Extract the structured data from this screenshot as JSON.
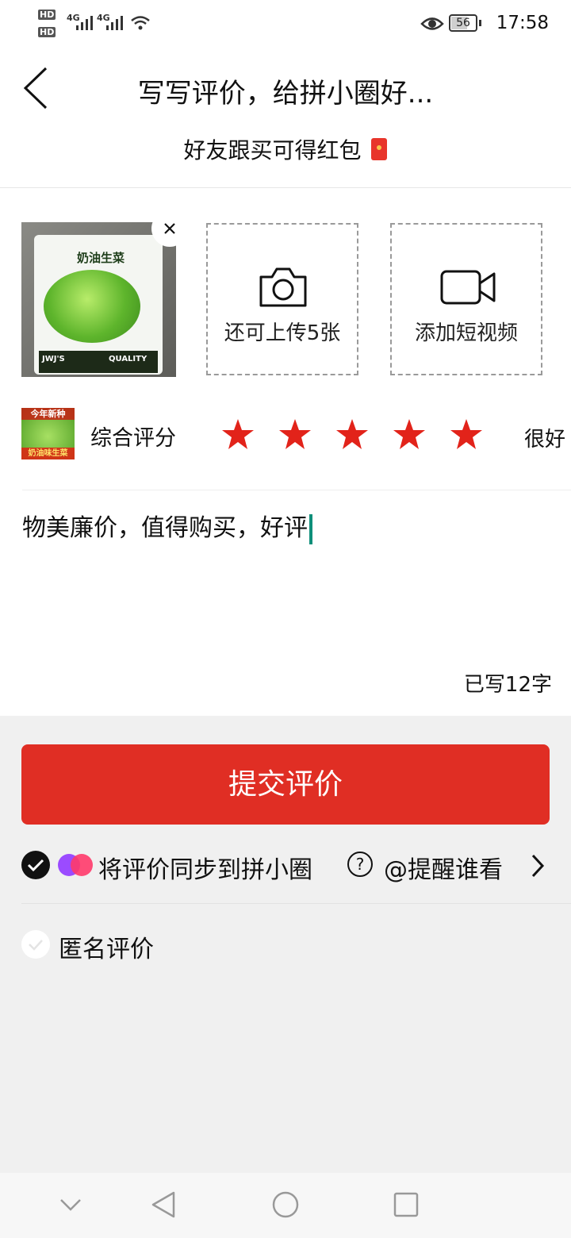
{
  "status_bar": {
    "hd1": "HD",
    "hd2": "HD",
    "net1": "4G",
    "net2": "4G",
    "battery": "56",
    "time": "17:58"
  },
  "header": {
    "title": "写写评价，给拼小圈好...",
    "subtitle": "好友跟买可得红包"
  },
  "uploads": {
    "photo_pack_brand": "奶油生菜",
    "photo_pack_brand2": "JWJ'S",
    "photo_pack_quality": "QUALITY",
    "photo_label": "还可上传5张",
    "video_label": "添加短视频"
  },
  "rating": {
    "thumb_top": "今年新种",
    "thumb_bottom": "奶油味生菜",
    "label": "综合评分",
    "stars": 5,
    "result": "很好"
  },
  "review": {
    "text": "物美廉价，值得购买，好评",
    "count": "已写12字"
  },
  "submit_label": "提交评价",
  "sync": {
    "label": "将评价同步到拼小圈",
    "help": "?",
    "remind": "@提醒谁看"
  },
  "anonymous_label": "匿名评价",
  "colors": {
    "accent": "#e02e24",
    "star": "#e2231a"
  }
}
